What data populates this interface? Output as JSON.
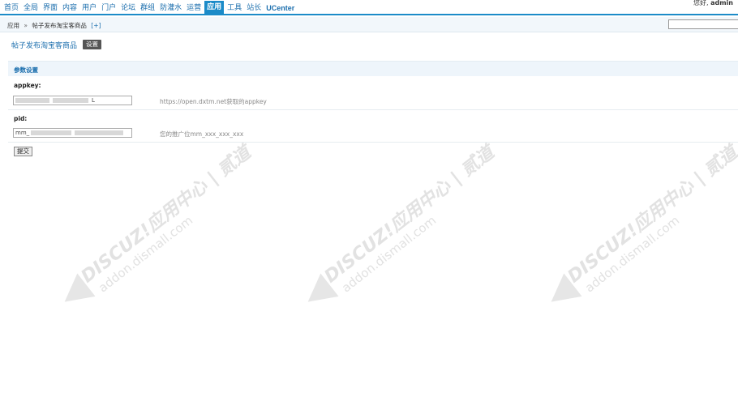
{
  "nav": {
    "items": [
      {
        "label": "首页"
      },
      {
        "label": "全局"
      },
      {
        "label": "界面"
      },
      {
        "label": "内容"
      },
      {
        "label": "用户"
      },
      {
        "label": "门户"
      },
      {
        "label": "论坛"
      },
      {
        "label": "群组"
      },
      {
        "label": "防灌水"
      },
      {
        "label": "运营"
      },
      {
        "label": "应用"
      },
      {
        "label": "工具"
      },
      {
        "label": "站长"
      },
      {
        "label": "UCenter"
      }
    ],
    "active_index": 10,
    "greeting_prefix": "您好, ",
    "username": "admin"
  },
  "breadcrumb": {
    "root": "应用",
    "separator": "»",
    "current": "帖子发布淘宝客商品",
    "add": "[+]"
  },
  "page": {
    "title": "帖子发布淘宝客商品",
    "settings_button": "设置"
  },
  "section": {
    "title": "参数设置"
  },
  "fields": {
    "appkey": {
      "label": "appkey:",
      "value_tail": "L",
      "hint": "https://open.dxtm.net获取的appkey"
    },
    "pid": {
      "label": "pid:",
      "value_prefix": "mm_",
      "hint": "您的推广位mm_xxx_xxx_xxx"
    }
  },
  "submit_label": "提交",
  "watermark": {
    "line1": "DISCUZ!应用中心 | 贰道",
    "line2": "addon.dismall.com"
  }
}
